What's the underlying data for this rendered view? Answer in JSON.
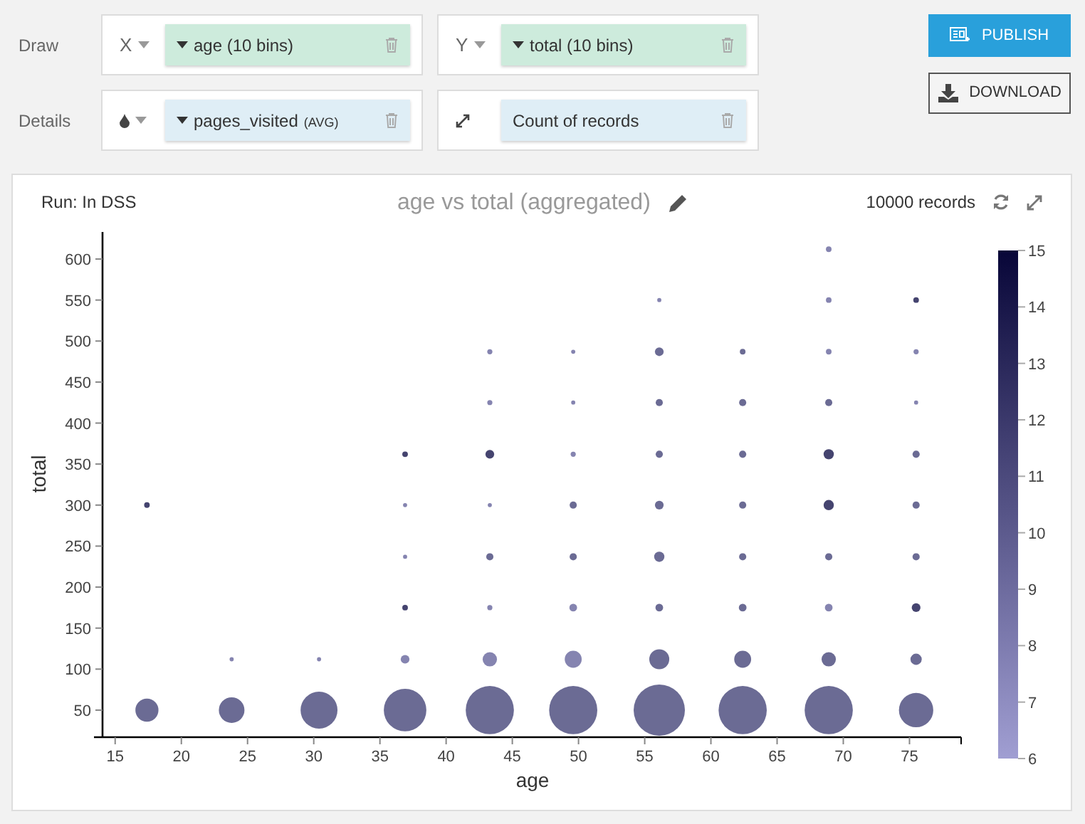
{
  "config": {
    "rows": [
      {
        "label": "Draw",
        "slots": [
          {
            "kind": "axis",
            "prefix": "X",
            "field": "age (10 bins)"
          },
          {
            "kind": "axis",
            "prefix": "Y",
            "field": "total (10 bins)"
          }
        ]
      },
      {
        "label": "Details",
        "slots": [
          {
            "kind": "color",
            "field": "pages_visited",
            "aggregate": "(AVG)"
          },
          {
            "kind": "size",
            "field": "Count of records"
          }
        ]
      }
    ]
  },
  "buttons": [
    {
      "kind": "publish",
      "label": "PUBLISH"
    },
    {
      "kind": "download",
      "label": "DOWNLOAD"
    }
  ],
  "chart": {
    "run": "Run: In DSS",
    "title": "age vs total (aggregated)",
    "records": "10000 records",
    "chart_data": {
      "type": "scatter",
      "xlabel": "age",
      "ylabel": "total",
      "xlim": [
        13.4,
        78.9
      ],
      "ylim": [
        17,
        633
      ],
      "xticks": [
        15,
        20,
        25,
        30,
        35,
        40,
        45,
        50,
        55,
        60,
        65,
        70,
        75
      ],
      "yticks": [
        50,
        100,
        150,
        200,
        250,
        300,
        350,
        400,
        450,
        500,
        550,
        600
      ],
      "series": [
        {
          "color": "#8584b0",
          "x": [
            23.8,
            30.4,
            36.9,
            36.9,
            36.9,
            43.3,
            43.3,
            43.3,
            43.3,
            43.3,
            49.6,
            49.6,
            49.6,
            49.6,
            49.6,
            56.1,
            68.9,
            68.9,
            68.9,
            68.9,
            75.5,
            75.5
          ],
          "values": [
            112,
            112,
            112,
            237,
            300,
            112,
            175,
            300,
            425,
            487,
            112,
            175,
            362,
            425,
            487,
            550,
            175,
            487,
            550,
            612,
            425,
            487
          ],
          "sizes": [
            0.0064,
            0.0064,
            0.0289,
            0.0064,
            0.0064,
            0.0784,
            0.01,
            0.0064,
            0.01,
            0.01,
            0.1089,
            0.0225,
            0.01,
            0.0064,
            0.0064,
            0.0064,
            0.0225,
            0.012,
            0.012,
            0.012,
            0.0064,
            0.01
          ]
        },
        {
          "color": "#6b6b94",
          "x": [
            17.4,
            23.8,
            30.4,
            36.9,
            43.3,
            43.3,
            49.6,
            49.6,
            49.6,
            56.1,
            56.1,
            56.1,
            56.1,
            56.1,
            56.1,
            56.1,
            56.1,
            62.4,
            62.4,
            62.4,
            62.4,
            62.4,
            62.4,
            62.4,
            62.4,
            68.9,
            68.9,
            68.9,
            68.9,
            75.5,
            75.5,
            75.5,
            75.5,
            75.5
          ],
          "values": [
            50,
            50,
            50,
            50,
            50,
            237,
            50,
            237,
            300,
            50,
            112,
            175,
            237,
            300,
            362,
            425,
            487,
            50,
            112,
            175,
            237,
            300,
            362,
            425,
            487,
            50,
            112,
            237,
            425,
            50,
            112,
            237,
            300,
            362
          ],
          "sizes": [
            0.2025,
            0.25,
            0.5184,
            0.6889,
            0.8836,
            0.0196,
            0.8836,
            0.0196,
            0.0196,
            1.0,
            0.1521,
            0.0225,
            0.04,
            0.0289,
            0.0196,
            0.0196,
            0.0289,
            0.8836,
            0.1089,
            0.0225,
            0.0196,
            0.0196,
            0.0196,
            0.0196,
            0.0121,
            0.8836,
            0.0784,
            0.0196,
            0.0196,
            0.4489,
            0.0484,
            0.0196,
            0.0196,
            0.0196
          ]
        },
        {
          "color": "#45446f",
          "x": [
            17.4,
            36.9,
            36.9,
            43.3,
            68.9,
            68.9,
            75.5,
            75.5
          ],
          "values": [
            300,
            175,
            362,
            362,
            300,
            362,
            175,
            550
          ],
          "sizes": [
            0.012,
            0.0121,
            0.0121,
            0.0289,
            0.04,
            0.04,
            0.0289,
            0.012
          ]
        }
      ]
    },
    "color_legend": {
      "ticks": [
        "15",
        "14",
        "13",
        "12",
        "11",
        "10",
        "9",
        "8",
        "7",
        "6"
      ]
    }
  }
}
